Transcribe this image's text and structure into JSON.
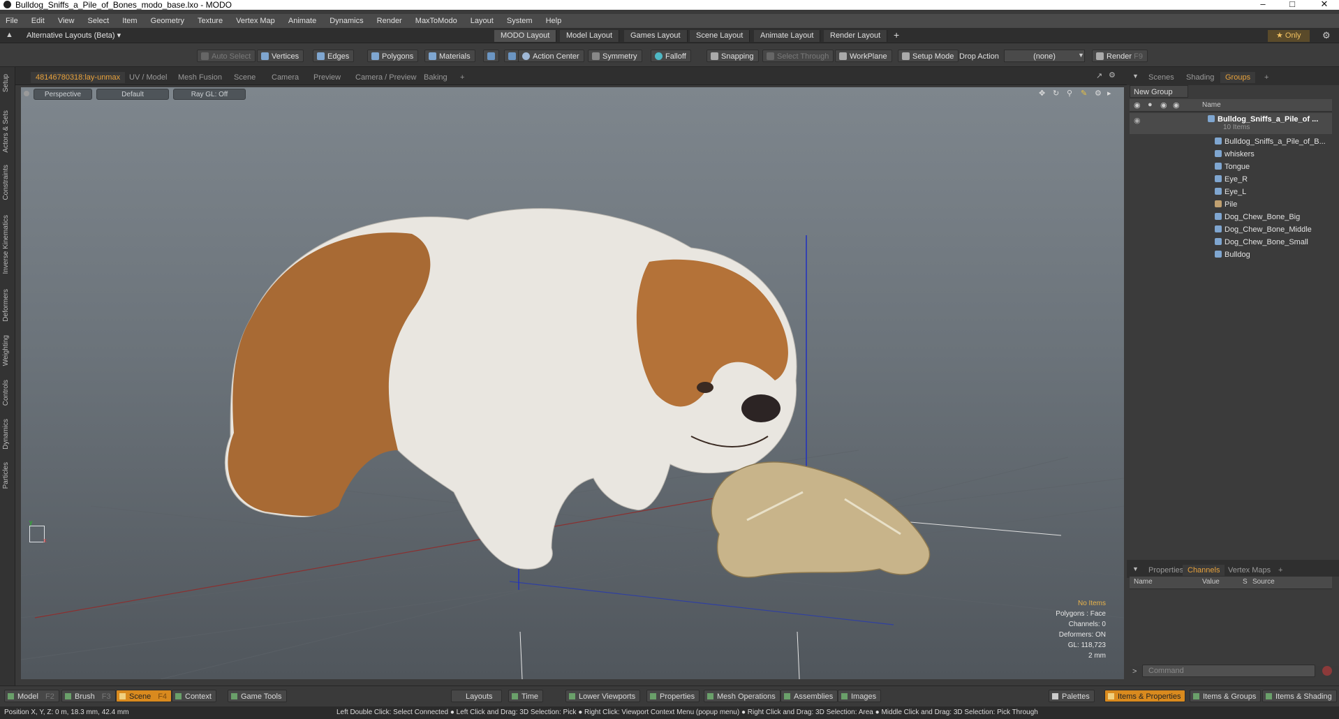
{
  "window": {
    "title": "Bulldog_Sniffs_a_Pile_of_Bones_modo_base.lxo - MODO",
    "controls": [
      "–",
      "□",
      "✕"
    ]
  },
  "menu": [
    "File",
    "Edit",
    "View",
    "Select",
    "Item",
    "Geometry",
    "Texture",
    "Vertex Map",
    "Animate",
    "Dynamics",
    "Render",
    "MaxToModo",
    "Layout",
    "System",
    "Help"
  ],
  "layouts": {
    "alt_label": "Alternative Layouts (Beta) ▾",
    "tabs": [
      "MODO Layout",
      "Model Layout",
      "Games Layout",
      "Scene Layout",
      "Animate Layout",
      "Render Layout"
    ],
    "add": "+",
    "only": "★ Only"
  },
  "toolbar": {
    "auto_select": "Auto Select",
    "vertices": "Vertices",
    "edges": "Edges",
    "polygons": "Polygons",
    "materials": "Materials",
    "action_center": "Action Center",
    "symmetry": "Symmetry",
    "falloff": "Falloff",
    "snapping": "Snapping",
    "select_through": "Select Through",
    "workplane": "WorkPlane",
    "setup_mode": "Setup Mode",
    "drop_action": "Drop Action",
    "drop_value": "(none)",
    "render": "Render",
    "render_key": "F9"
  },
  "left_tabs": [
    "Setup",
    "Actors & Sets",
    "Constraints",
    "Inverse Kinematics",
    "Deformers",
    "Weighting",
    "Controls",
    "Dynamics",
    "Particles"
  ],
  "viewport_tabs": [
    "48146780318:lay-unmax",
    "UV / Model",
    "Mesh Fusion",
    "Scene",
    "Camera",
    "Preview",
    "Camera / Preview",
    "Baking",
    "+"
  ],
  "viewport": {
    "view": "Perspective",
    "shading": "Default",
    "raygl": "Ray GL: Off",
    "info": {
      "items": "No Items",
      "polygons": "Polygons : Face",
      "channels": "Channels: 0",
      "deformers": "Deformers: ON",
      "gl": "GL: 118,723",
      "scale": "2 mm"
    }
  },
  "right_tabs": [
    "Scenes",
    "Shading",
    "Groups",
    "+"
  ],
  "groups": {
    "new_group": "New Group",
    "name_header": "Name",
    "root": "Bulldog_Sniffs_a_Pile_of ...",
    "root_count": "10 Items",
    "items": [
      "Bulldog_Sniffs_a_Pile_of_B...",
      "whiskers",
      "Tongue",
      "Eye_R",
      "Eye_L",
      "Pile",
      "Dog_Chew_Bone_Big",
      "Dog_Chew_Bone_Middle",
      "Dog_Chew_Bone_Small",
      "Bulldog"
    ]
  },
  "channel_tabs": [
    "Properties",
    "Channels",
    "Vertex Maps",
    "+"
  ],
  "channels": {
    "headers": [
      "Name",
      "Value",
      "S",
      "Source"
    ]
  },
  "command_placeholder": "Command",
  "bottom": {
    "model": "Model",
    "model_key": "F2",
    "brush": "Brush",
    "brush_key": "F3",
    "scene": "Scene",
    "scene_key": "F4",
    "context": "Context",
    "game_tools": "Game Tools",
    "layouts": "Layouts",
    "time": "Time",
    "lower_viewports": "Lower Viewports",
    "properties": "Properties",
    "mesh_operations": "Mesh Operations",
    "assemblies": "Assemblies",
    "images": "Images",
    "palettes": "Palettes",
    "items_properties": "Items & Properties",
    "items_groups": "Items & Groups",
    "items_shading": "Items & Shading"
  },
  "status": {
    "position": "Position X, Y, Z:   0 m, 18.3 mm, 42.4 mm",
    "hints": "Left Double Click: Select Connected ● Left Click and Drag: 3D Selection: Pick ● Right Click: Viewport Context Menu (popup menu) ● Right Click and Drag: 3D Selection: Area ● Middle Click and Drag: 3D Selection: Pick Through"
  },
  "colors": {
    "accent": "#e8a23c",
    "active_button": "#d98a1e"
  }
}
